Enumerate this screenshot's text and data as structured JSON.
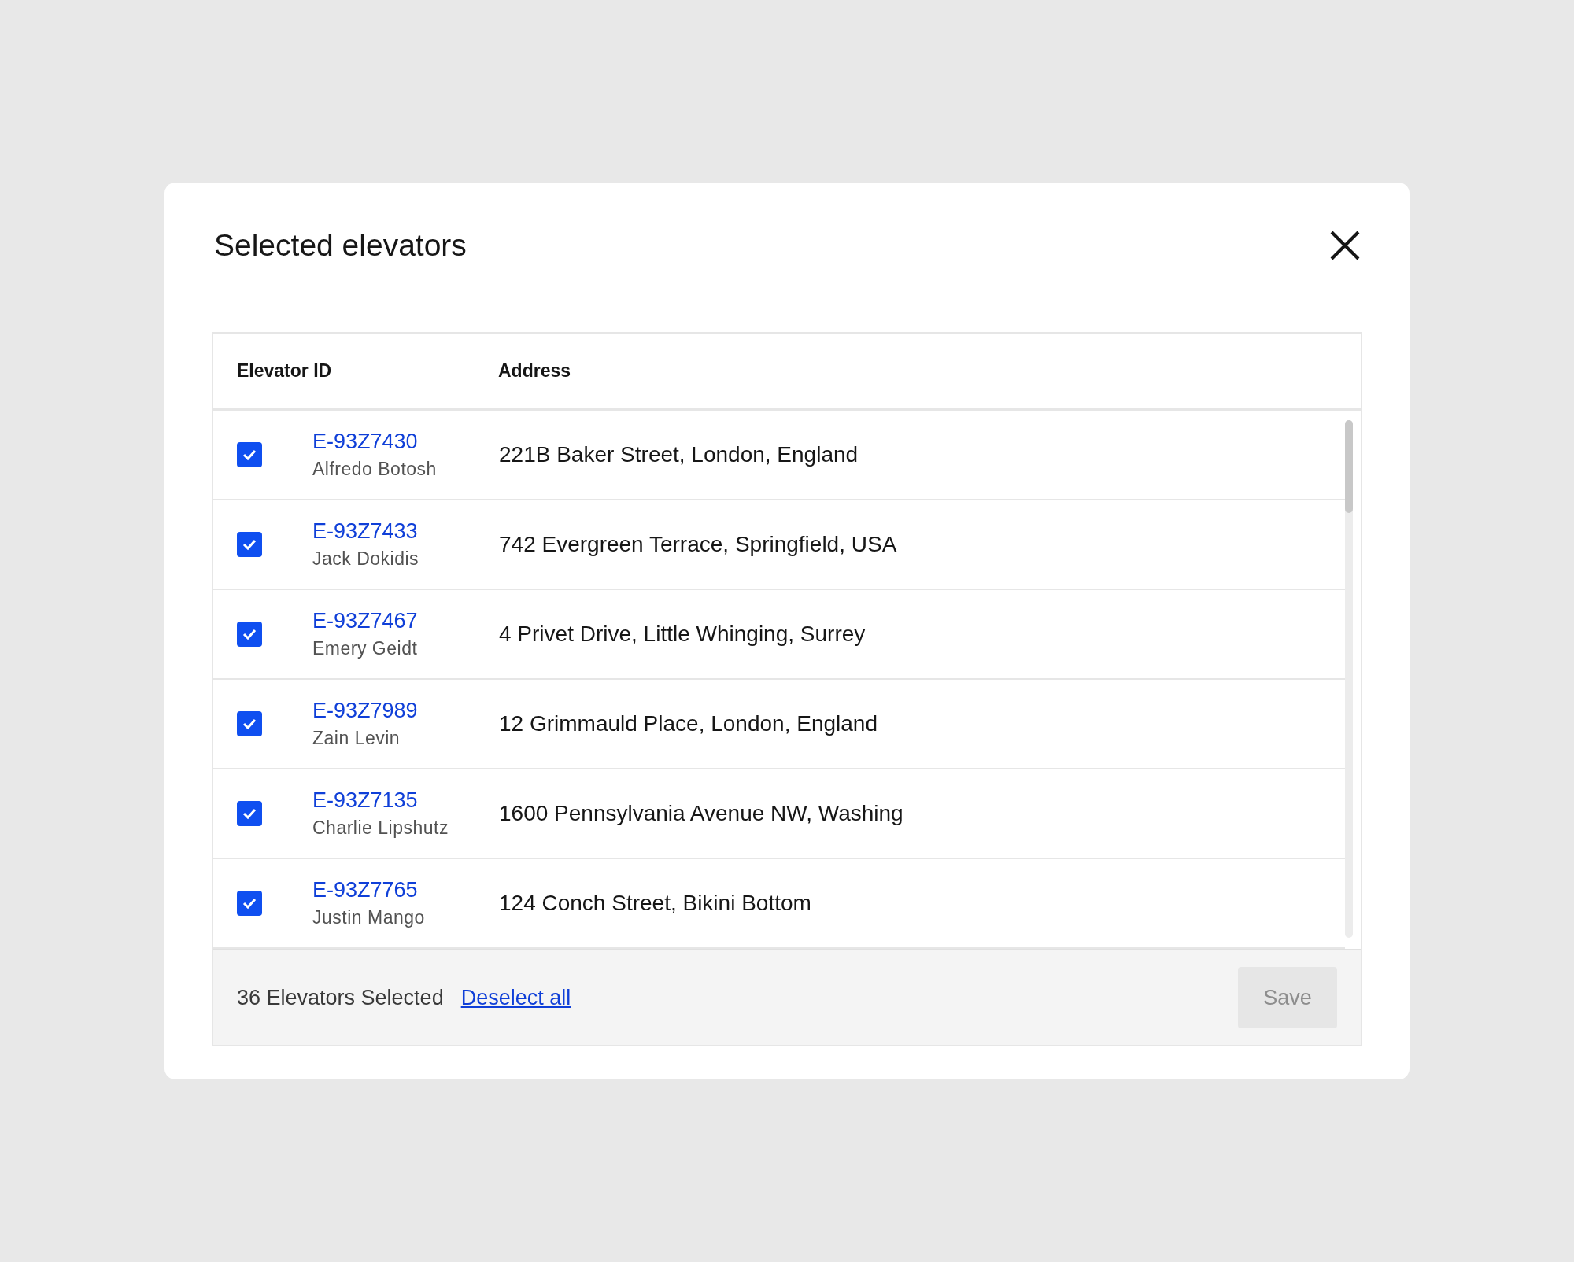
{
  "dialog": {
    "title": "Selected elevators"
  },
  "table": {
    "columns": [
      "Elevator ID",
      "Address"
    ],
    "rows": [
      {
        "checked": true,
        "id": "E-93Z7430",
        "name": "Alfredo Botosh",
        "address": "221B Baker Street, London, England"
      },
      {
        "checked": true,
        "id": "E-93Z7433",
        "name": "Jack Dokidis",
        "address": "742 Evergreen Terrace, Springfield, USA"
      },
      {
        "checked": true,
        "id": "E-93Z7467",
        "name": "Emery Geidt",
        "address": "4 Privet Drive, Little Whinging, Surrey"
      },
      {
        "checked": true,
        "id": "E-93Z7989",
        "name": "Zain Levin",
        "address": "12 Grimmauld Place, London, England"
      },
      {
        "checked": true,
        "id": "E-93Z7135",
        "name": "Charlie Lipshutz",
        "address": "1600 Pennsylvania Avenue NW, Washing"
      },
      {
        "checked": true,
        "id": "E-93Z7765",
        "name": "Justin Mango",
        "address": "124 Conch Street, Bikini Bottom"
      }
    ]
  },
  "footer": {
    "count": "36 Elevators Selected",
    "link": "Deselect all",
    "save": {
      "label": "Save",
      "disabled": true
    }
  }
}
